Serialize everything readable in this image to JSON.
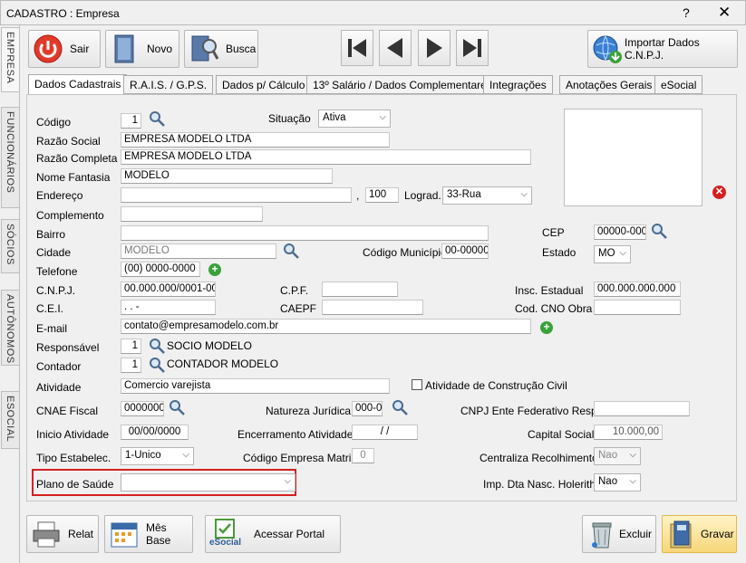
{
  "window": {
    "title": "CADASTRO : Empresa",
    "help": "?",
    "close": "✕"
  },
  "side_tabs": [
    "EMPRESA",
    "FUNCIONÁRIOS",
    "SÓCIOS",
    "AUTÔNOMOS",
    "ESOCIAL"
  ],
  "toolbar": {
    "sair": "Sair",
    "novo": "Novo",
    "busca": "Busca",
    "importar": "Importar Dados C.N.P.J."
  },
  "tabs": [
    "Dados Cadastrais",
    "R.A.I.S. / G.P.S.",
    "Dados p/ Cálculo",
    "13º Salário / Dados Complementares",
    "Integrações",
    "Anotações Gerais",
    "eSocial"
  ],
  "form": {
    "codigo_label": "Código",
    "codigo": "1",
    "situacao_label": "Situação",
    "situacao": "Ativa",
    "razao_social_label": "Razão Social",
    "razao_social": "EMPRESA MODELO LTDA",
    "razao_completa_label": "Razão Completa",
    "razao_completa": "EMPRESA MODELO LTDA",
    "nome_fantasia_label": "Nome Fantasia",
    "nome_fantasia": "MODELO",
    "endereco_label": "Endereço",
    "endereco": "",
    "comma": ",",
    "numero": "100",
    "lograd_label": "Lograd.",
    "lograd": "33-Rua",
    "complemento_label": "Complemento",
    "complemento": "",
    "bairro_label": "Bairro",
    "bairro": "",
    "cep_label": "CEP",
    "cep": "00000-000",
    "cidade_label": "Cidade",
    "cidade": "MODELO",
    "cod_municipio_label": "Código Município",
    "cod_municipio": "00-00000",
    "estado_label": "Estado",
    "estado": "MO",
    "telefone_label": "Telefone",
    "telefone": "(00) 0000-0000",
    "cnpj_label": "C.N.P.J.",
    "cnpj": "00.000.000/0001-00",
    "cpf_label": "C.P.F.",
    "cpf": "",
    "insc_estadual_label": "Insc. Estadual",
    "insc_estadual": "000.000.000.000",
    "cei_label": "C.E.I.",
    "cei": ".        .          -",
    "caepf_label": "CAEPF",
    "caepf": "",
    "cno_label": "Cod. CNO Obra",
    "cno": "",
    "email_label": "E-mail",
    "email": "contato@empresamodelo.com.br",
    "responsavel_label": "Responsável",
    "responsavel_code": "1",
    "responsavel_name": "SOCIO MODELO",
    "contador_label": "Contador",
    "contador_code": "1",
    "contador_name": "CONTADOR MODELO",
    "atividade_label": "Atividade",
    "atividade": "Comercio varejista",
    "atividade_construcao_label": "Atividade de Construção Civil",
    "cnae_label": "CNAE Fiscal",
    "cnae": "0000000",
    "natureza_label": "Natureza Jurídica",
    "natureza": "000-0",
    "cnpj_ente_label": "CNPJ Ente Federativo Resp.",
    "cnpj_ente": "",
    "inicio_label": "Inicio Atividade",
    "inicio": "00/00/0000",
    "encerramento_label": "Encerramento Atividade",
    "encerramento": "/  /",
    "capital_label": "Capital Social",
    "capital": "10.000,00",
    "tipo_label": "Tipo Estabelec.",
    "tipo": "1-Unico",
    "matriz_label": "Código Empresa Matriz",
    "matriz": "0",
    "centraliza_label": "Centraliza Recolhimento",
    "centraliza": "Nao",
    "plano_label": "Plano de Saúde",
    "plano": "",
    "imp_label": "Imp. Dta Nasc. Holerith",
    "imp": "Nao"
  },
  "bottom": {
    "relat": "Relat",
    "mes_base": "Mês Base",
    "portal": "Acessar Portal",
    "esocial_logo": "eSocial",
    "excluir": "Excluir",
    "gravar": "Gravar"
  },
  "colors": {
    "highlight_border": "#d62020",
    "add_green": "#3aa13a",
    "delete_red": "#d42020"
  }
}
